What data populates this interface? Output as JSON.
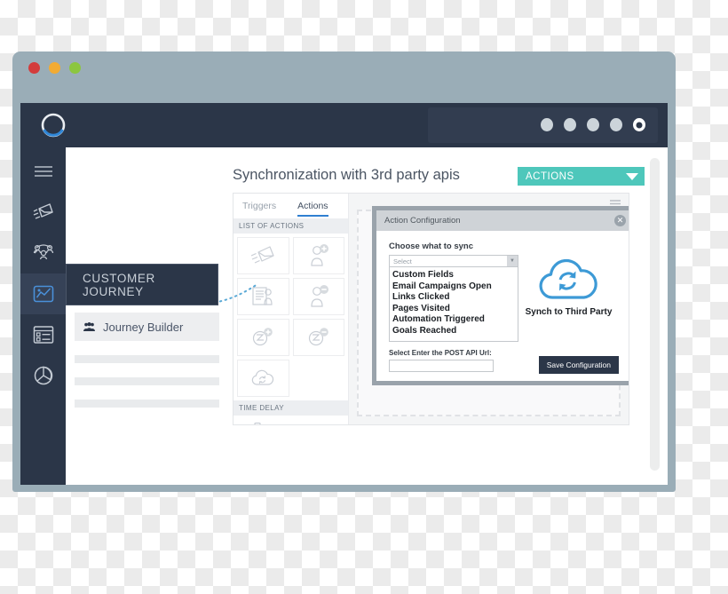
{
  "browser": {
    "traffic_lights": [
      {
        "name": "close",
        "color": "#d33c3c"
      },
      {
        "name": "minimize",
        "color": "#f2ab33"
      },
      {
        "name": "maximize",
        "color": "#8cc63f"
      }
    ],
    "url_value": "",
    "url_placeholder": ""
  },
  "app_header": {
    "logo_name": "brand-logo",
    "dots_count": 5
  },
  "icon_rail": {
    "items": [
      {
        "id": "menu",
        "icon": "hamburger-icon",
        "label": "Menu",
        "active": false
      },
      {
        "id": "campaigns",
        "icon": "paper-plane-envelope-icon",
        "label": "Campaigns",
        "active": false
      },
      {
        "id": "audience",
        "icon": "audience-network-icon",
        "label": "Audience",
        "active": false
      },
      {
        "id": "customer-journey",
        "icon": "chart-image-icon",
        "label": "Customer Journey",
        "active": true
      },
      {
        "id": "forms",
        "icon": "form-list-icon",
        "label": "Forms",
        "active": false
      },
      {
        "id": "reports",
        "icon": "pie-chart-icon",
        "label": "Reports",
        "active": false
      }
    ]
  },
  "flyout": {
    "label": "CUSTOMER JOURNEY"
  },
  "nav": {
    "active_item": {
      "icon": "people-group-icon",
      "label": "Journey Builder"
    },
    "placeholder_rows": 3
  },
  "main": {
    "page_title": "Synchronization with 3rd party apis",
    "actions_dropdown": {
      "label": "ACTIONS",
      "caret_icon": "caret-down-icon",
      "color": "#4ec7bb"
    },
    "canvas_menu_icon": "hamburger-menu-icon"
  },
  "builder": {
    "tabs": [
      {
        "label": "Triggers",
        "active": false
      },
      {
        "label": "Actions",
        "active": true
      }
    ],
    "accent_color": "#2f7fd1",
    "sections": [
      {
        "heading": "LIST OF ACTIONS",
        "items": [
          {
            "icon": "send-email-icon",
            "label": "Send Email"
          },
          {
            "icon": "add-contact-icon",
            "label": "Add Contact"
          },
          {
            "icon": "form-contact-icon",
            "label": "Assign Form"
          },
          {
            "icon": "remove-contact-icon",
            "label": "Remove Contact"
          },
          {
            "icon": "add-tag-icon",
            "label": "Add Tag"
          },
          {
            "icon": "remove-tag-icon",
            "label": "Remove Tag"
          },
          {
            "icon": "cloud-sync-icon",
            "label": "Sync to Third Party"
          }
        ]
      },
      {
        "heading": "TIME DELAY",
        "items": [
          {
            "icon": "stopwatch-icon",
            "label": "Time Delay"
          }
        ]
      }
    ]
  },
  "modal": {
    "title": "Action Configuration",
    "close_icon": "close-icon",
    "sync_field": {
      "label": "Choose what to sync",
      "select_value": "Select",
      "select_placeholder": "Select",
      "arrow_icon": "chevron-down-icon",
      "options": [
        "Custom Fields",
        "Email Campaigns Open",
        "Links Clicked",
        "Pages Visited",
        "Automation Triggered",
        "Goals Reached"
      ]
    },
    "url_field": {
      "label": "Select  Enter the POST API Url:",
      "value": "",
      "placeholder": ""
    },
    "illustration": {
      "icon": "cloud-sync-icon",
      "caption": "Synch to Third Party",
      "color": "#3d9ad6"
    },
    "save_button": "Save Configuration"
  }
}
